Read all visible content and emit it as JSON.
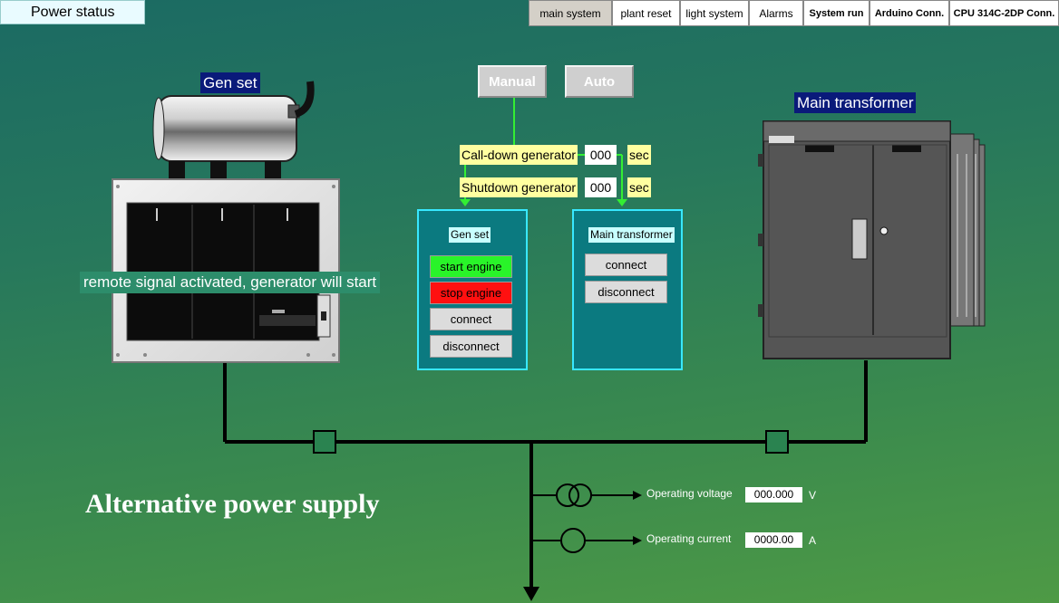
{
  "header": {
    "title": "Power status"
  },
  "nav": [
    {
      "label": "main system",
      "active": true,
      "bold": false
    },
    {
      "label": "plant reset",
      "active": false,
      "bold": false
    },
    {
      "label": "light system",
      "active": false,
      "bold": false
    },
    {
      "label": "Alarms",
      "active": false,
      "bold": false
    },
    {
      "label": "System run",
      "active": false,
      "bold": true
    },
    {
      "label": "Arduino Conn.",
      "active": false,
      "bold": true
    },
    {
      "label": "CPU 314C-2DP Conn.",
      "active": false,
      "bold": true
    }
  ],
  "genset": {
    "label": "Gen set",
    "status_message": "remote signal activated, generator will start"
  },
  "transformer": {
    "label": "Main transformer"
  },
  "mode": {
    "manual": "Manual",
    "auto": "Auto"
  },
  "timers": {
    "calldown": {
      "label": "Call-down generator",
      "value": "000",
      "unit": "sec"
    },
    "shutdown": {
      "label": "Shutdown generator",
      "value": "000",
      "unit": "sec"
    }
  },
  "genset_panel": {
    "title": "Gen set",
    "start": "start engine",
    "stop": "stop engine",
    "connect": "connect",
    "disconnect": "disconnect"
  },
  "transformer_panel": {
    "title": "Main transformer",
    "connect": "connect",
    "disconnect": "disconnect"
  },
  "section": {
    "title": "Alternative power supply"
  },
  "measurements": {
    "voltage": {
      "label": "Operating voltage",
      "value": "000.000",
      "unit": "V"
    },
    "current": {
      "label": "Operating current",
      "value": "0000.00",
      "unit": "A"
    }
  },
  "colors": {
    "start_button": "#29f429",
    "stop_button": "#ff1010",
    "panel_border": "#38e8ff",
    "signal_line": "#33ee33"
  }
}
